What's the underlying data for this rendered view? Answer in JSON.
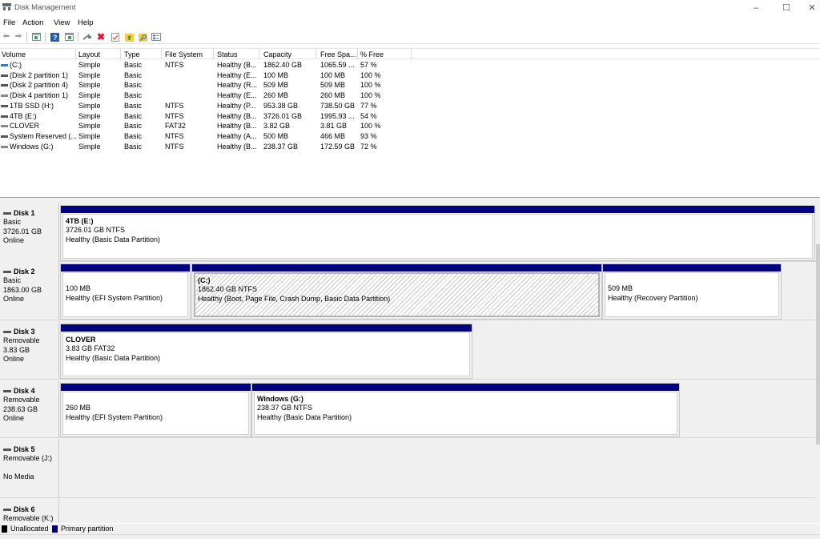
{
  "window": {
    "title": "Disk Management",
    "controls": {
      "minimize": "–",
      "maximize": "☐",
      "close": "✕"
    }
  },
  "menu": [
    "File",
    "Action",
    "View",
    "Help"
  ],
  "toolbar": {
    "icons": [
      "back-icon",
      "forward-icon",
      "show-hide-console-tree-icon",
      "help-icon",
      "show-hide-action-pane-icon",
      "connect-icon",
      "delete-icon",
      "check-icon",
      "folder-up-icon",
      "search-folder-icon",
      "properties-icon"
    ],
    "colors": {
      "delete": "#e81123",
      "help": "#1e5fb4",
      "folder": "#f3cc4a"
    }
  },
  "volume_table": {
    "columns": [
      "Volume",
      "Layout",
      "Type",
      "File System",
      "Status",
      "Capacity",
      "Free Spa...",
      "% Free"
    ],
    "rows": [
      {
        "volume": "(C:)",
        "layout": "Simple",
        "type": "Basic",
        "fs": "NTFS",
        "status": "Healthy (B...",
        "capacity": "1862.40 GB",
        "free": "1065.59 ...",
        "pct": "57 %",
        "icon": "blue"
      },
      {
        "volume": "(Disk 2 partition 1)",
        "layout": "Simple",
        "type": "Basic",
        "fs": "",
        "status": "Healthy (E...",
        "capacity": "100 MB",
        "free": "100 MB",
        "pct": "100 %",
        "icon": "dark"
      },
      {
        "volume": "(Disk 2 partition 4)",
        "layout": "Simple",
        "type": "Basic",
        "fs": "",
        "status": "Healthy (R...",
        "capacity": "509 MB",
        "free": "509 MB",
        "pct": "100 %",
        "icon": "dark"
      },
      {
        "volume": "(Disk 4 partition 1)",
        "layout": "Simple",
        "type": "Basic",
        "fs": "",
        "status": "Healthy (E...",
        "capacity": "260 MB",
        "free": "260 MB",
        "pct": "100 %",
        "icon": "light"
      },
      {
        "volume": "1TB SSD (H:)",
        "layout": "Simple",
        "type": "Basic",
        "fs": "NTFS",
        "status": "Healthy (P...",
        "capacity": "953.38 GB",
        "free": "738.50 GB",
        "pct": "77 %",
        "icon": "dark"
      },
      {
        "volume": "4TB (E:)",
        "layout": "Simple",
        "type": "Basic",
        "fs": "NTFS",
        "status": "Healthy (B...",
        "capacity": "3726.01 GB",
        "free": "1995.93 ...",
        "pct": "54 %",
        "icon": "dark"
      },
      {
        "volume": "CLOVER",
        "layout": "Simple",
        "type": "Basic",
        "fs": "FAT32",
        "status": "Healthy (B...",
        "capacity": "3.82 GB",
        "free": "3.81 GB",
        "pct": "100 %",
        "icon": "light"
      },
      {
        "volume": "System Reserved (...",
        "layout": "Simple",
        "type": "Basic",
        "fs": "NTFS",
        "status": "Healthy (A...",
        "capacity": "500 MB",
        "free": "466 MB",
        "pct": "93 %",
        "icon": "dark"
      },
      {
        "volume": "Windows (G:)",
        "layout": "Simple",
        "type": "Basic",
        "fs": "NTFS",
        "status": "Healthy (B...",
        "capacity": "238.37 GB",
        "free": "172.59 GB",
        "pct": "72 %",
        "icon": "light"
      }
    ]
  },
  "disks": [
    {
      "name": "Disk 1",
      "kind": "Basic",
      "size": "3726.01 GB",
      "state": "Online",
      "partitions": [
        {
          "title": "4TB  (E:)",
          "size": "3726.01 GB NTFS",
          "status": "Healthy (Basic Data Partition)",
          "hatched": false
        }
      ]
    },
    {
      "name": "Disk 2",
      "kind": "Basic",
      "size": "1863.00 GB",
      "state": "Online",
      "partitions": [
        {
          "title": "",
          "size": "100 MB",
          "status": "Healthy (EFI System Partition)",
          "hatched": false
        },
        {
          "title": "(C:)",
          "size": "1862.40 GB NTFS",
          "status": "Healthy (Boot, Page File, Crash Dump, Basic Data Partition)",
          "hatched": true
        },
        {
          "title": "",
          "size": "509 MB",
          "status": "Healthy (Recovery Partition)",
          "hatched": false
        }
      ]
    },
    {
      "name": "Disk 3",
      "kind": "Removable",
      "size": "3.83 GB",
      "state": "Online",
      "partitions": [
        {
          "title": "CLOVER",
          "size": "3.83 GB FAT32",
          "status": "Healthy (Basic Data Partition)",
          "hatched": false
        }
      ]
    },
    {
      "name": "Disk 4",
      "kind": "Removable",
      "size": "238.63 GB",
      "state": "Online",
      "partitions": [
        {
          "title": "",
          "size": "260 MB",
          "status": "Healthy (EFI System Partition)",
          "hatched": false
        },
        {
          "title": "Windows  (G:)",
          "size": "238.37 GB NTFS",
          "status": "Healthy (Basic Data Partition)",
          "hatched": false
        }
      ]
    },
    {
      "name": "Disk 5",
      "kind": "Removable (J:)",
      "size": "",
      "state": "No Media",
      "partitions": []
    },
    {
      "name": "Disk 6",
      "kind": "Removable (K:)",
      "size": "",
      "state": "",
      "partitions": []
    }
  ],
  "legend": [
    {
      "label": "Unallocated",
      "color": "#000000"
    },
    {
      "label": "Primary partition",
      "color": "#000080"
    }
  ]
}
